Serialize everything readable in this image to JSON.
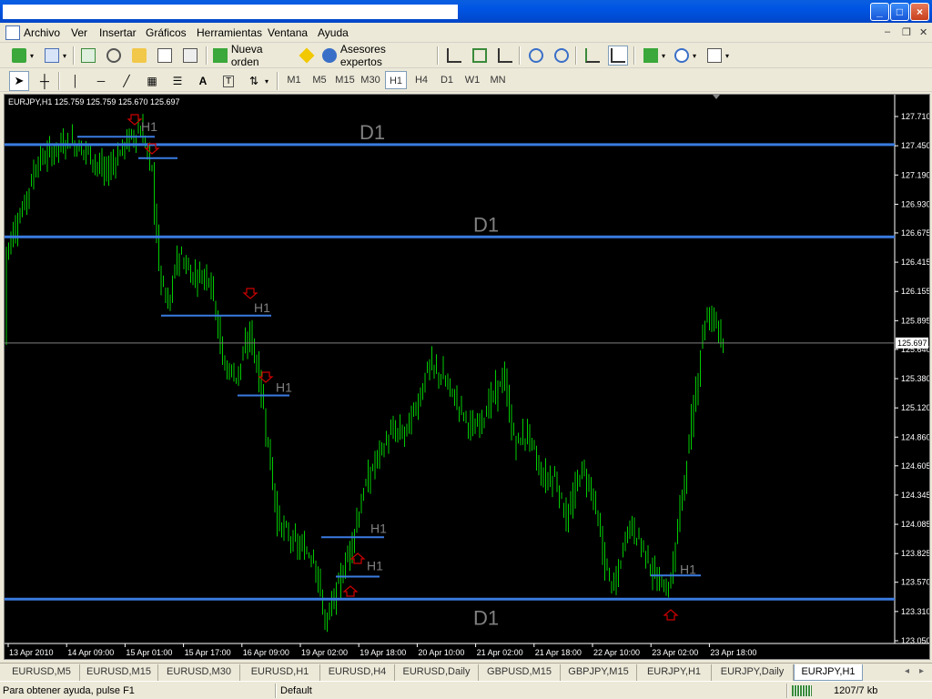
{
  "menu": [
    "Archivo",
    "Ver",
    "Insertar",
    "Gráficos",
    "Herramientas",
    "Ventana",
    "Ayuda"
  ],
  "toolbar": {
    "new_order_label": "Nueva orden",
    "experts_label": "Asesores expertos"
  },
  "timeframes": [
    "M1",
    "M5",
    "M15",
    "M30",
    "H1",
    "H4",
    "D1",
    "W1",
    "MN"
  ],
  "active_timeframe": "H1",
  "chart_data": {
    "type": "bar",
    "symbol_info": "EURJPY,H1  125.759 125.759 125.670 125.697",
    "current_price": "125.697",
    "y_ticks": [
      "127.710",
      "127.450",
      "127.190",
      "126.930",
      "126.675",
      "126.415",
      "126.155",
      "125.895",
      "125.640",
      "125.380",
      "125.120",
      "124.860",
      "124.605",
      "124.345",
      "124.085",
      "123.825",
      "123.570",
      "123.310",
      "123.050"
    ],
    "ylim": [
      123.05,
      127.71
    ],
    "x_ticks": [
      "13 Apr 2010",
      "14 Apr 09:00",
      "15 Apr 01:00",
      "15 Apr 17:00",
      "16 Apr 09:00",
      "19 Apr 02:00",
      "19 Apr 18:00",
      "20 Apr 10:00",
      "21 Apr 02:00",
      "21 Apr 18:00",
      "22 Apr 10:00",
      "23 Apr 02:00",
      "23 Apr 18:00"
    ],
    "levels": [
      {
        "label": "D1",
        "price": 127.46
      },
      {
        "label": "D1",
        "price": 126.64
      },
      {
        "label": "D1",
        "price": 123.42
      }
    ],
    "short_levels": [
      {
        "label": "H1",
        "price": 127.53
      },
      {
        "label": "",
        "price": 127.34
      },
      {
        "label": "H1",
        "price": 125.94
      },
      {
        "label": "H1",
        "price": 125.23
      },
      {
        "label": "H1",
        "price": 123.97
      },
      {
        "label": "H1",
        "price": 123.62
      },
      {
        "label": "H1",
        "price": 123.63
      }
    ],
    "colors": {
      "candles": "#00CC00",
      "levels": "#3A7BE0",
      "price_line": "#808080",
      "arrows": "#CC0000",
      "level_labels": "#808080"
    }
  },
  "tabs": [
    "EURUSD,M5",
    "EURUSD,M15",
    "EURUSD,M30",
    "EURUSD,H1",
    "EURUSD,H4",
    "EURUSD,Daily",
    "GBPUSD,M15",
    "GBPJPY,M15",
    "EURJPY,H1",
    "EURJPY,Daily",
    "EURJPY,H1"
  ],
  "active_tab_index": 10,
  "status": {
    "help": "Para obtener ayuda, pulse F1",
    "profile": "Default",
    "traffic": "1207/7 kb"
  }
}
